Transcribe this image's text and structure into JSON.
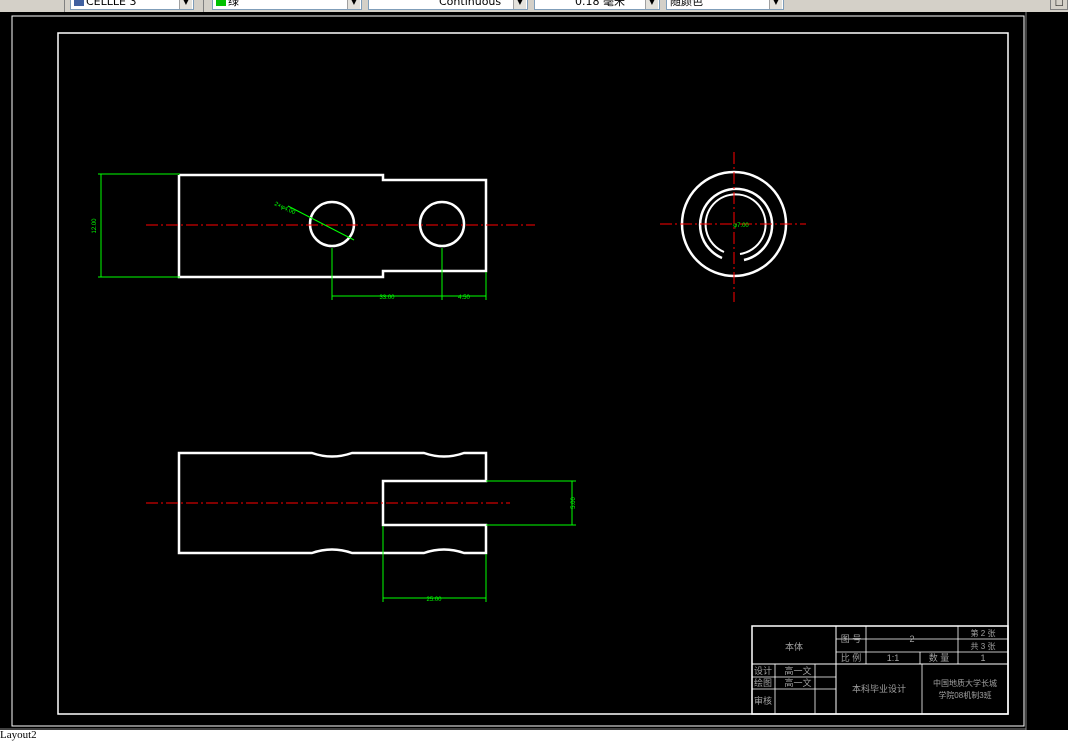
{
  "toolbar": {
    "layer_name": "CELLLE 3",
    "color_value": "绿",
    "linetype_value": "Continuous",
    "lineweight_value": "0.18 毫米",
    "plotstyle_value": "随颜色"
  },
  "drawing": {
    "dims": {
      "left_height": "12.00",
      "hole_leader": "2×φ4.00",
      "bottom_span_1": "33.00",
      "bottom_span_2": "4.50",
      "circle_center": "φ7.00",
      "right_height": "5.00",
      "lower_width": "25.00"
    }
  },
  "title_block": {
    "part_name": "本体",
    "drawing_no_label": "图 号",
    "drawing_no_value": "2",
    "sheet_no": "第 2 张",
    "sheet_total": "共 3 张",
    "scale_label": "比 例",
    "scale_value": "1:1",
    "qty_label": "数 量",
    "qty_value": "1",
    "design_label": "设计",
    "design_name": "高一文",
    "draw_label": "绘图",
    "draw_name": "高一文",
    "review_label": "审核",
    "project": "本科毕业设计",
    "school_line1": "中国地质大学长城",
    "school_line2": "学院08机制3班"
  },
  "layout_tab": "Layout2",
  "colors": {
    "outline": "#ffffff",
    "center_line": "#ff0000",
    "dimension": "#00ff00",
    "background": "#000000"
  }
}
